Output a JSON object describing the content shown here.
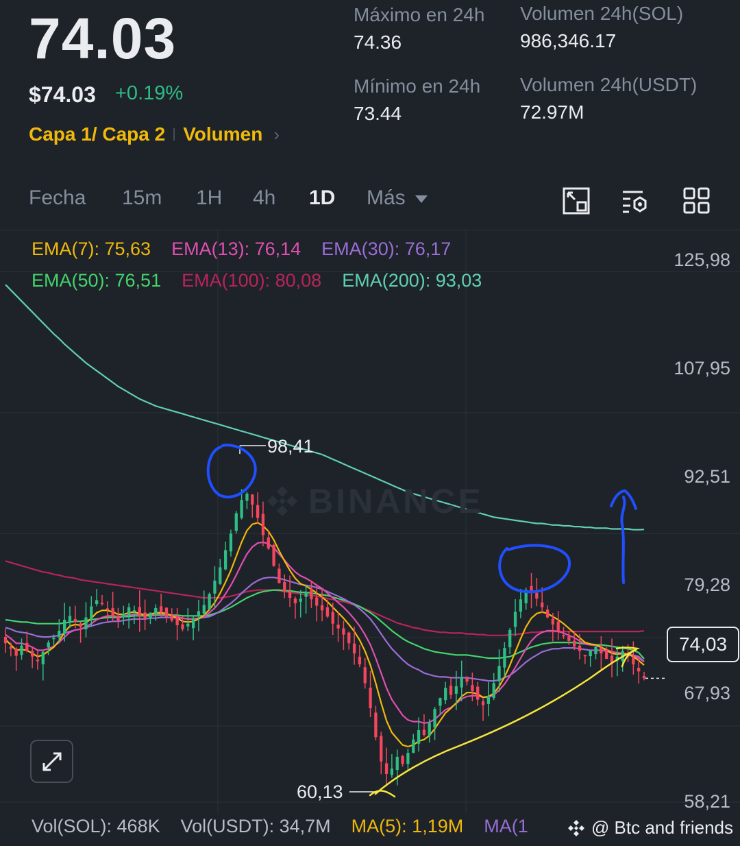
{
  "header": {
    "price": "74.03",
    "price_usd": "$74.03",
    "change": "+0.19%",
    "layer_label": "Capa 1/ Capa 2",
    "volume_link": "Volumen"
  },
  "stats": {
    "high_label": "Máximo en 24h",
    "high_value": "74.36",
    "low_label": "Mínimo en 24h",
    "low_value": "73.44",
    "vol_sol_label": "Volumen 24h(SOL)",
    "vol_sol_value": "986,346.17",
    "vol_usdt_label": "Volumen 24h(USDT)",
    "vol_usdt_value": "72.97M"
  },
  "tabs": [
    "Fecha",
    "15m",
    "1H",
    "4h",
    "1D",
    "Más"
  ],
  "active_tab": "1D",
  "toolbar_icons": [
    "chart-expand-icon",
    "indicator-settings-icon",
    "layout-grid-icon"
  ],
  "ema": {
    "ema7": "EMA(7): 75,63",
    "ema13": "EMA(13): 76,14",
    "ema30": "EMA(30): 76,17",
    "ema50": "EMA(50): 76,51",
    "ema100": "EMA(100): 80,08",
    "ema200": "EMA(200): 93,03"
  },
  "colors": {
    "ema7": "#f0b90b",
    "ema13": "#e04fb2",
    "ema30": "#9a6ed6",
    "ema50": "#44d36c",
    "ema100": "#b8245a",
    "ema200": "#5fd0b3",
    "up": "#2ebd85",
    "down": "#f6465d",
    "annotation_blue": "#1f4fff",
    "annotation_yellow": "#f5e53c"
  },
  "axis": {
    "ticks": [
      "125,98",
      "107,95",
      "92,51",
      "79,28",
      "67,93",
      "58,21"
    ],
    "current_price": "74,03"
  },
  "annotations": {
    "high": "98,41",
    "low": "60,13"
  },
  "watermark": "BINANCE",
  "volume": {
    "vol_sol": "Vol(SOL): 468K",
    "vol_usdt": "Vol(USDT): 34,7M",
    "ma5": "MA(5): 1,19M",
    "ma10": "MA(1"
  },
  "credit": "@ Btc and friends",
  "chart_data": {
    "type": "candlestick",
    "ylim": [
      58.21,
      125.98
    ],
    "y_ticks": [
      125.98,
      107.95,
      92.51,
      79.28,
      67.93,
      58.21
    ],
    "current_price": 74.03,
    "high_marker": 98.41,
    "low_marker": 60.13,
    "closes": [
      78.5,
      77.8,
      76.9,
      78.2,
      77.5,
      76.8,
      76.2,
      77.4,
      78.6,
      79.2,
      80.1,
      81.5,
      82.0,
      81.2,
      80.6,
      81.8,
      83.2,
      84.0,
      83.5,
      82.8,
      82.0,
      81.4,
      82.3,
      83.1,
      82.7,
      82.0,
      81.6,
      82.4,
      83.0,
      82.5,
      81.9,
      81.4,
      80.8,
      80.3,
      81.0,
      81.7,
      82.6,
      83.4,
      84.8,
      86.5,
      88.2,
      90.4,
      92.5,
      95.1,
      96.8,
      97.6,
      96.2,
      94.5,
      92.3,
      90.6,
      88.4,
      86.2,
      85.1,
      84.3,
      83.6,
      84.2,
      85.0,
      84.1,
      83.3,
      82.7,
      81.9,
      81.0,
      80.4,
      79.6,
      78.5,
      77.2,
      75.8,
      73.4,
      70.2,
      66.5,
      63.4,
      61.8,
      62.5,
      64.0,
      63.1,
      64.5,
      66.2,
      67.4,
      66.8,
      68.3,
      70.1,
      71.5,
      72.8,
      71.9,
      73.0,
      74.2,
      73.6,
      72.4,
      71.3,
      70.6,
      71.8,
      73.4,
      75.6,
      77.9,
      80.2,
      82.5,
      84.1,
      85.3,
      85.0,
      84.2,
      83.1,
      81.8,
      80.9,
      80.1,
      79.4,
      78.8,
      78.1,
      77.5,
      76.9,
      77.6,
      78.0,
      77.2,
      76.5,
      76.0,
      76.8,
      77.5,
      76.9,
      75.8,
      74.9,
      74.03
    ],
    "ema7": [
      79.0,
      78.3,
      77.6,
      77.7,
      77.6,
      77.2,
      76.8,
      77.0,
      77.5,
      78.0,
      78.8,
      79.9,
      80.7,
      80.9,
      80.8,
      81.1,
      81.7,
      82.4,
      82.7,
      82.7,
      82.5,
      82.2,
      82.2,
      82.4,
      82.5,
      82.3,
      82.1,
      82.2,
      82.4,
      82.4,
      82.3,
      82.0,
      81.7,
      81.3,
      81.2,
      81.3,
      81.6,
      82.1,
      82.8,
      83.7,
      84.9,
      86.3,
      87.8,
      89.6,
      91.4,
      92.9,
      93.7,
      93.9,
      93.5,
      92.8,
      91.7,
      90.3,
      89.0,
      87.8,
      86.8,
      86.1,
      85.8,
      85.4,
      84.9,
      84.4,
      83.8,
      83.1,
      82.4,
      81.7,
      80.9,
      80.0,
      78.9,
      77.5,
      75.7,
      73.4,
      70.9,
      68.6,
      67.1,
      66.3,
      65.5,
      65.3,
      65.5,
      66.0,
      66.2,
      66.7,
      67.6,
      68.6,
      69.6,
      70.2,
      70.9,
      71.7,
      72.2,
      72.2,
      72.0,
      71.6,
      71.7,
      72.1,
      73.0,
      74.2,
      75.7,
      77.4,
      79.1,
      80.6,
      81.7,
      82.3,
      82.5,
      82.3,
      81.9,
      81.5,
      81.0,
      80.4,
      79.8,
      79.2,
      78.6,
      78.4,
      78.3,
      78.0,
      77.6,
      77.2,
      77.1,
      77.2,
      77.1,
      76.8,
      76.3,
      75.7
    ],
    "ema13": [
      79.6,
      79.1,
      78.5,
      78.5,
      78.3,
      78.0,
      77.6,
      77.6,
      77.8,
      78.1,
      78.6,
      79.3,
      79.9,
      80.2,
      80.3,
      80.6,
      81.0,
      81.5,
      81.8,
      82.0,
      82.0,
      81.9,
      82.0,
      82.1,
      82.2,
      82.2,
      82.1,
      82.1,
      82.2,
      82.3,
      82.2,
      82.1,
      81.9,
      81.7,
      81.6,
      81.6,
      81.7,
      81.9,
      82.4,
      83.0,
      83.8,
      84.8,
      85.9,
      87.2,
      88.6,
      89.9,
      90.8,
      91.3,
      91.4,
      91.2,
      90.7,
      89.9,
      89.1,
      88.3,
      87.6,
      87.1,
      86.8,
      86.4,
      85.9,
      85.5,
      84.9,
      84.3,
      83.7,
      83.1,
      82.4,
      81.6,
      80.7,
      79.6,
      78.3,
      76.6,
      74.7,
      72.8,
      71.3,
      70.3,
      69.3,
      68.7,
      68.5,
      68.5,
      68.3,
      68.4,
      68.8,
      69.4,
      70.0,
      70.3,
      70.8,
      71.4,
      71.7,
      71.8,
      71.8,
      71.6,
      71.6,
      71.9,
      72.5,
      73.3,
      74.3,
      75.4,
      76.6,
      77.8,
      78.8,
      79.5,
      79.9,
      80.1,
      80.1,
      80.0,
      79.8,
      79.5,
      79.2,
      78.8,
      78.4,
      78.3,
      78.2,
      78.0,
      77.7,
      77.4,
      77.3,
      77.2,
      77.1,
      76.9,
      76.6,
      76.14
    ],
    "ema30": [
      80.5,
      80.3,
      80.0,
      79.9,
      79.8,
      79.6,
      79.4,
      79.3,
      79.3,
      79.4,
      79.5,
      79.8,
      80.0,
      80.2,
      80.3,
      80.5,
      80.7,
      80.9,
      81.1,
      81.2,
      81.3,
      81.3,
      81.4,
      81.5,
      81.6,
      81.6,
      81.6,
      81.7,
      81.7,
      81.8,
      81.8,
      81.8,
      81.7,
      81.7,
      81.6,
      81.6,
      81.7,
      81.8,
      81.9,
      82.2,
      82.6,
      83.1,
      83.6,
      84.2,
      84.9,
      85.5,
      86.1,
      86.5,
      86.8,
      86.9,
      86.9,
      86.8,
      86.6,
      86.4,
      86.2,
      86.0,
      85.9,
      85.8,
      85.6,
      85.4,
      85.1,
      84.8,
      84.5,
      84.2,
      83.8,
      83.4,
      82.9,
      82.3,
      81.6,
      80.7,
      79.7,
      78.7,
      77.8,
      77.1,
      76.4,
      75.8,
      75.4,
      75.1,
      74.7,
      74.5,
      74.3,
      74.2,
      74.2,
      74.1,
      74.1,
      74.1,
      74.1,
      74.0,
      73.9,
      73.8,
      73.7,
      73.7,
      73.8,
      74.1,
      74.4,
      74.9,
      75.5,
      76.1,
      76.6,
      77.0,
      77.4,
      77.6,
      77.8,
      77.8,
      77.9,
      77.9,
      77.9,
      77.8,
      77.7,
      77.6,
      77.6,
      77.6,
      77.5,
      77.4,
      77.3,
      77.2,
      77.1,
      77.0,
      76.8,
      76.17
    ],
    "ema50": [
      81.5,
      81.4,
      81.3,
      81.2,
      81.2,
      81.1,
      81.0,
      81.0,
      81.0,
      81.0,
      81.0,
      81.1,
      81.2,
      81.3,
      81.3,
      81.4,
      81.5,
      81.6,
      81.7,
      81.8,
      81.8,
      81.8,
      81.9,
      81.9,
      82.0,
      82.0,
      82.0,
      82.0,
      82.1,
      82.1,
      82.1,
      82.1,
      82.1,
      82.0,
      82.0,
      82.0,
      82.0,
      82.0,
      82.1,
      82.3,
      82.5,
      82.8,
      83.1,
      83.5,
      83.9,
      84.3,
      84.6,
      84.9,
      85.1,
      85.2,
      85.3,
      85.3,
      85.2,
      85.2,
      85.1,
      85.0,
      85.0,
      84.9,
      84.8,
      84.7,
      84.6,
      84.4,
      84.2,
      84.0,
      83.8,
      83.5,
      83.2,
      82.8,
      82.4,
      81.9,
      81.3,
      80.7,
      80.1,
      79.6,
      79.1,
      78.7,
      78.4,
      78.1,
      77.8,
      77.6,
      77.4,
      77.3,
      77.2,
      77.1,
      77.0,
      77.0,
      77.0,
      76.9,
      76.8,
      76.7,
      76.6,
      76.6,
      76.6,
      76.7,
      76.8,
      77.1,
      77.4,
      77.7,
      78.0,
      78.2,
      78.4,
      78.5,
      78.6,
      78.6,
      78.6,
      78.6,
      78.6,
      78.5,
      78.4,
      78.4,
      78.3,
      78.3,
      78.2,
      78.1,
      78.0,
      77.9,
      77.8,
      77.6,
      77.3,
      76.51
    ],
    "ema100": [
      89.0,
      88.8,
      88.6,
      88.4,
      88.2,
      88.0,
      87.8,
      87.6,
      87.5,
      87.3,
      87.2,
      87.0,
      86.9,
      86.8,
      86.6,
      86.5,
      86.4,
      86.3,
      86.2,
      86.1,
      86.0,
      85.9,
      85.8,
      85.7,
      85.6,
      85.5,
      85.4,
      85.3,
      85.2,
      85.1,
      85.0,
      84.9,
      84.8,
      84.7,
      84.6,
      84.5,
      84.4,
      84.3,
      84.3,
      84.3,
      84.3,
      84.4,
      84.5,
      84.7,
      84.9,
      85.1,
      85.2,
      85.3,
      85.3,
      85.3,
      85.3,
      85.2,
      85.1,
      85.0,
      84.9,
      84.8,
      84.7,
      84.6,
      84.5,
      84.4,
      84.2,
      84.1,
      83.9,
      83.8,
      83.6,
      83.4,
      83.2,
      82.9,
      82.6,
      82.3,
      82.0,
      81.7,
      81.4,
      81.1,
      80.9,
      80.7,
      80.5,
      80.4,
      80.2,
      80.1,
      80.0,
      79.9,
      79.9,
      79.8,
      79.8,
      79.8,
      79.7,
      79.7,
      79.6,
      79.6,
      79.5,
      79.5,
      79.5,
      79.5,
      79.6,
      79.6,
      79.7,
      79.8,
      79.9,
      79.9,
      80.0,
      80.0,
      80.0,
      80.0,
      80.0,
      80.0,
      80.0,
      80.0,
      80.0,
      80.0,
      80.0,
      80.0,
      80.0,
      80.0,
      80.0,
      80.0,
      80.0,
      80.0,
      80.0,
      80.08
    ],
    "ema200": [
      124.3,
      123.6,
      122.9,
      122.2,
      121.5,
      120.8,
      120.1,
      119.4,
      118.7,
      118.0,
      117.4,
      116.7,
      116.1,
      115.5,
      114.9,
      114.3,
      113.8,
      113.3,
      112.8,
      112.3,
      111.8,
      111.3,
      110.9,
      110.5,
      110.1,
      109.7,
      109.4,
      109.1,
      108.8,
      108.6,
      108.4,
      108.2,
      108.0,
      107.8,
      107.6,
      107.4,
      107.2,
      107.0,
      106.8,
      106.6,
      106.4,
      106.2,
      106.0,
      105.8,
      105.6,
      105.4,
      105.2,
      105.0,
      104.8,
      104.6,
      104.4,
      104.2,
      104.0,
      103.8,
      103.6,
      103.4,
      103.2,
      103.0,
      102.8,
      102.6,
      102.3,
      102.0,
      101.7,
      101.4,
      101.1,
      100.8,
      100.5,
      100.2,
      99.9,
      99.6,
      99.3,
      99.0,
      98.7,
      98.4,
      98.1,
      97.8,
      97.6,
      97.4,
      97.2,
      97.0,
      96.8,
      96.6,
      96.4,
      96.2,
      96.0,
      95.8,
      95.6,
      95.4,
      95.2,
      95.0,
      94.8,
      94.6,
      94.5,
      94.4,
      94.3,
      94.2,
      94.1,
      94.0,
      93.9,
      93.8,
      93.8,
      93.7,
      93.6,
      93.6,
      93.5,
      93.5,
      93.4,
      93.4,
      93.3,
      93.3,
      93.2,
      93.2,
      93.2,
      93.1,
      93.1,
      93.1,
      93.1,
      93.0,
      93.0,
      93.03
    ]
  }
}
